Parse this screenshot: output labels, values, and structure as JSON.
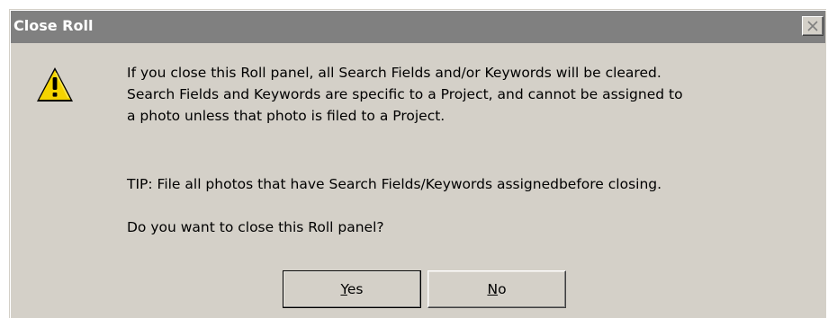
{
  "window": {
    "title": "Close Roll",
    "close_icon": "close-x-icon"
  },
  "icon": {
    "name": "warning-icon",
    "color": "#f5d400"
  },
  "message": {
    "line1": "If you close this Roll panel, all Search Fields and/or Keywords will be cleared.",
    "line2": "Search Fields and Keywords are specific to a Project, and cannot be assigned to",
    "line3": "a photo unless that photo is filed to a Project.",
    "tip": "TIP: File all photos that have Search Fields/Keywords assignedbefore closing.",
    "question": "Do you want to close this Roll panel?"
  },
  "buttons": {
    "yes_mnemonic": "Y",
    "yes_rest": "es",
    "no_mnemonic": "N",
    "no_rest": "o"
  }
}
